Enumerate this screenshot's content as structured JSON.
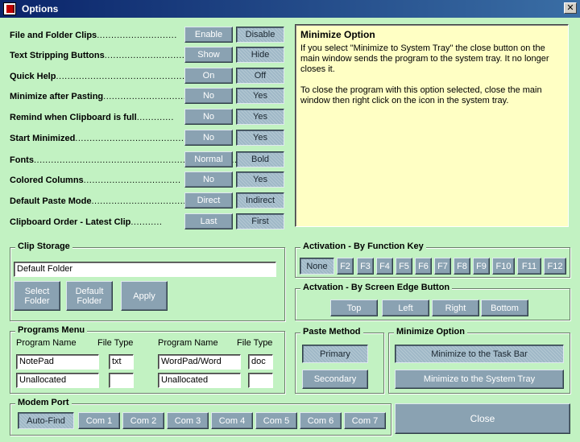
{
  "window": {
    "title": "Options",
    "close_glyph": "✕",
    "icon": "app-icon"
  },
  "settings": [
    {
      "label": "File and Folder Clips",
      "dots": "............................",
      "options": [
        "Enable",
        "Disable"
      ],
      "selected": 1
    },
    {
      "label": "Text Stripping Buttons",
      "dots": "............................",
      "options": [
        "Show",
        "Hide"
      ],
      "selected": 1
    },
    {
      "label": "Quick Help",
      "dots": ".....................................................",
      "options": [
        "On",
        "Off"
      ],
      "selected": 1
    },
    {
      "label": "Minimize after Pasting",
      "dots": "...............................",
      "options": [
        "No",
        "Yes"
      ],
      "selected": 1
    },
    {
      "label": "Remind when Clipboard is full",
      "dots": ".............",
      "options": [
        "No",
        "Yes"
      ],
      "selected": 1
    },
    {
      "label": "Start Minimized",
      "dots": "................................................",
      "options": [
        "No",
        "Yes"
      ],
      "selected": 1
    },
    {
      "label": "Fonts",
      "dots": ".............................................................................",
      "options": [
        "Normal",
        "Bold"
      ],
      "selected": 1
    },
    {
      "label": "Colored Columns",
      "dots": "..................................",
      "options": [
        "No",
        "Yes"
      ],
      "selected": 1
    },
    {
      "label": "Default Paste Mode",
      "dots": "......................................",
      "options": [
        "Direct",
        "Indirect"
      ],
      "selected": 1
    },
    {
      "label": "Clipboard Order - Latest Clip",
      "dots": "...........",
      "options": [
        "Last",
        "First"
      ],
      "selected": 1
    }
  ],
  "info": {
    "title": "Minimize Option",
    "paragraph1": "If you select \"Minimize to System Tray\" the close button on the main window sends the program to the system tray. It no longer closes it.",
    "paragraph2": "To close the program with this option selected, close the main window then right click on the icon in the system tray."
  },
  "clip_storage": {
    "title": "Clip Storage",
    "folder_value": "Default Folder",
    "select_folder": [
      "Select",
      "Folder"
    ],
    "default_folder": [
      "Default",
      "Folder"
    ],
    "apply": "Apply"
  },
  "activation_key": {
    "title": "Activation - By Function Key",
    "keys": [
      "None",
      "F2",
      "F3",
      "F4",
      "F5",
      "F6",
      "F7",
      "F8",
      "F9",
      "F10",
      "F11",
      "F12"
    ],
    "selected": 0
  },
  "activation_edge": {
    "title": "Actvation - By Screen Edge Button",
    "edges": [
      "Top",
      "Left",
      "Right",
      "Bottom"
    ]
  },
  "programs_menu": {
    "title": "Programs Menu",
    "col_program": "Program Name",
    "col_type": "File Type",
    "left": [
      {
        "name": "NotePad",
        "type": "txt"
      },
      {
        "name": "Unallocated",
        "type": ""
      }
    ],
    "right": [
      {
        "name": "WordPad/Word",
        "type": "doc"
      },
      {
        "name": "Unallocated",
        "type": ""
      }
    ]
  },
  "paste_method": {
    "title": "Paste Method",
    "options": [
      "Primary",
      "Secondary"
    ],
    "selected": 0
  },
  "minimize_option": {
    "title": "Minimize Option",
    "options": [
      "Minimize to the Task Bar",
      "Minimize to the System Tray"
    ],
    "selected": 0
  },
  "modem_port": {
    "title": "Modem Port",
    "ports": [
      "Auto-Find",
      "Com 1",
      "Com 2",
      "Com 3",
      "Com 4",
      "Com 5",
      "Com 6",
      "Com 7"
    ],
    "selected": 0
  },
  "close_label": "Close"
}
